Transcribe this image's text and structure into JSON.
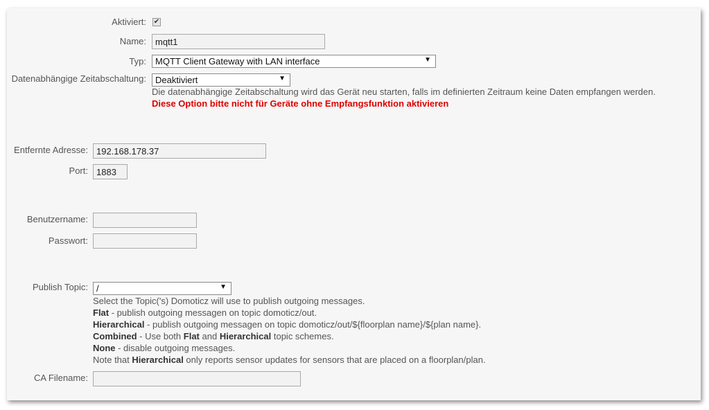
{
  "form": {
    "enabled": {
      "label": "Aktiviert:",
      "checked": true
    },
    "name": {
      "label": "Name:",
      "value": "mqtt1"
    },
    "type": {
      "label": "Typ:",
      "value": "MQTT Client Gateway with LAN interface"
    },
    "timeout": {
      "label": "Datenabhängige Zeitabschaltung:",
      "value": "Deaktiviert",
      "help": "Die datenabhängige Zeitabschaltung wird das Gerät neu starten, falls im definierten Zeitraum keine Daten empfangen werden.",
      "warning": "Diese Option bitte nicht für Geräte ohne Empfangsfunktion aktivieren"
    },
    "remote_address": {
      "label": "Entfernte Adresse:",
      "value": "192.168.178.37"
    },
    "port": {
      "label": "Port:",
      "value": "1883"
    },
    "username": {
      "label": "Benutzername:",
      "value": ""
    },
    "password": {
      "label": "Passwort:",
      "value": ""
    },
    "publish_topic": {
      "label": "Publish Topic:",
      "value": "/",
      "help_intro": "Select the Topic('s) Domoticz will use to publish outgoing messages.",
      "flat_term": "Flat",
      "flat_desc": " - publish outgoing messagen on topic domoticz/out.",
      "hier_term": "Hierarchical",
      "hier_desc": " - publish outgoing messagen on topic domoticz/out/${floorplan name}/${plan name}.",
      "combined_term": "Combined",
      "combined_mid": " - Use both ",
      "combined_flat": "Flat",
      "combined_and": " and ",
      "combined_hier": "Hierarchical",
      "combined_end": " topic schemes.",
      "none_term": "None",
      "none_desc": " - disable outgoing messages.",
      "note_start": "Note that ",
      "note_hier": "Hierarchical",
      "note_end": " only reports sensor updates for sensors that are placed on a floorplan/plan."
    },
    "ca_filename": {
      "label": "CA Filename:",
      "value": ""
    }
  },
  "colors": {
    "warning": "#e00000",
    "panel_bg": "#f6f6f6"
  }
}
